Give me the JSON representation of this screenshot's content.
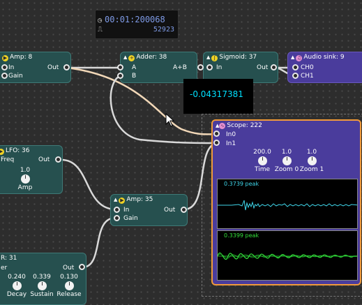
{
  "timer": {
    "time": "00:01:200068",
    "count": "52923"
  },
  "tooltip": {
    "value": "-0.04317381"
  },
  "nodes": {
    "amp_top": {
      "title": "Amp: 8",
      "in": "In",
      "gain": "Gain",
      "out": "Out"
    },
    "adder": {
      "title": "Adder: 38",
      "a": "A",
      "b": "B",
      "out": "A+B"
    },
    "sigmoid": {
      "title": "Sigmoid: 37",
      "in": "In",
      "out": "Out"
    },
    "audio_sink": {
      "title": "Audio sink: 9",
      "ch0": "CH0",
      "ch1": "CH1"
    },
    "lfo": {
      "title": "LFO: 36",
      "freq": "Freq",
      "out": "Out",
      "amp_value": "1.0",
      "amp_label": "Amp"
    },
    "amp_mid": {
      "title": "Amp: 35",
      "in": "In",
      "gain": "Gain",
      "out": "Out"
    },
    "adsr": {
      "title": "R: 31",
      "partial_label": "er",
      "out": "Out",
      "knobs": [
        {
          "value": "0.240",
          "label": "Decay"
        },
        {
          "value": "0.339",
          "label": "Sustain"
        },
        {
          "value": "0.130",
          "label": "Release"
        }
      ]
    },
    "scope": {
      "title": "Scope: 222",
      "in0": "In0",
      "in1": "In1",
      "knobs": [
        {
          "value": "200.0",
          "label": "Time"
        },
        {
          "value": "1.0",
          "label": "Zoom 0"
        },
        {
          "value": "1.0",
          "label": "Zoom 1"
        }
      ],
      "trace0": {
        "peak": "0.3739 peak",
        "color": "#3fd6ea"
      },
      "trace1": {
        "peak": "0.3399 peak",
        "color": "#33e03a"
      }
    }
  },
  "colors": {
    "node_teal": "#26504f",
    "node_purple": "#4a3c9c",
    "scope_border": "#f09a3a",
    "wire": "#d9d9d9",
    "wire_active": "#f2d8b8"
  }
}
